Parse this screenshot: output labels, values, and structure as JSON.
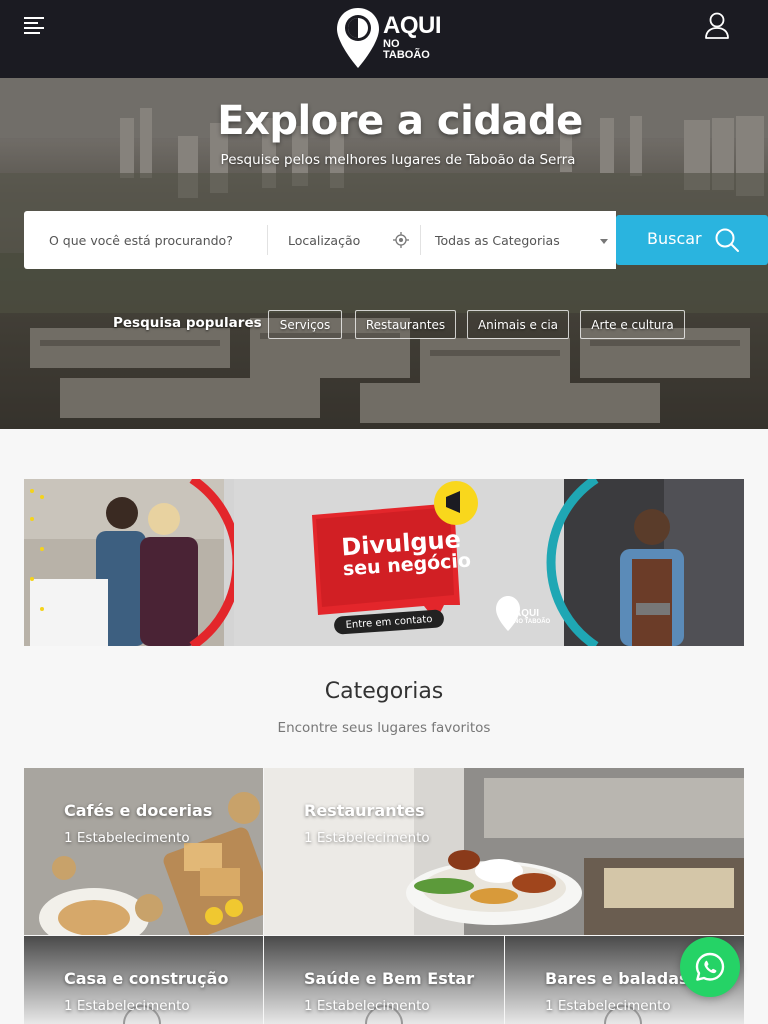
{
  "header": {
    "logo_line1": "AQUI",
    "logo_line2": "NO TABOÃO",
    "menu_icon": "hamburger-menu-icon",
    "user_icon": "user-icon"
  },
  "hero": {
    "title": "Explore a cidade",
    "subtitle": "Pesquise pelos melhores lugares de Taboão da Serra",
    "search": {
      "what_placeholder": "O que você está procurando?",
      "location_placeholder": "Localização",
      "category_selected": "Todas as Categorias",
      "button_label": "Buscar"
    },
    "popular_label": "Pesquisa populares",
    "popular_tags": [
      "Serviços",
      "Restaurantes",
      "Animais e cia",
      "Arte e cultura"
    ]
  },
  "banner": {
    "title_line1": "Divulgue",
    "title_line2": "seu negócio",
    "cta": "Entre em contato",
    "logo_line1": "AQUI",
    "logo_line2": "NO TABOÃO"
  },
  "categories": {
    "title": "Categorias",
    "subtitle": "Encontre seus lugares favoritos",
    "items": [
      {
        "name": "Cafés e docerias",
        "count": "1 Estabelecimento"
      },
      {
        "name": "Restaurantes",
        "count": "1 Estabelecimento"
      },
      {
        "name": "Casa e construção",
        "count": "1 Estabelecimento"
      },
      {
        "name": "Saúde e Bem Estar",
        "count": "1 Estabelecimento"
      },
      {
        "name": "Bares e baladas",
        "count": "1 Estabelecimento"
      }
    ]
  },
  "colors": {
    "header_bg": "#1b1b22",
    "accent": "#2ab4df",
    "banner_red": "#e3262b",
    "whatsapp": "#25d366"
  }
}
